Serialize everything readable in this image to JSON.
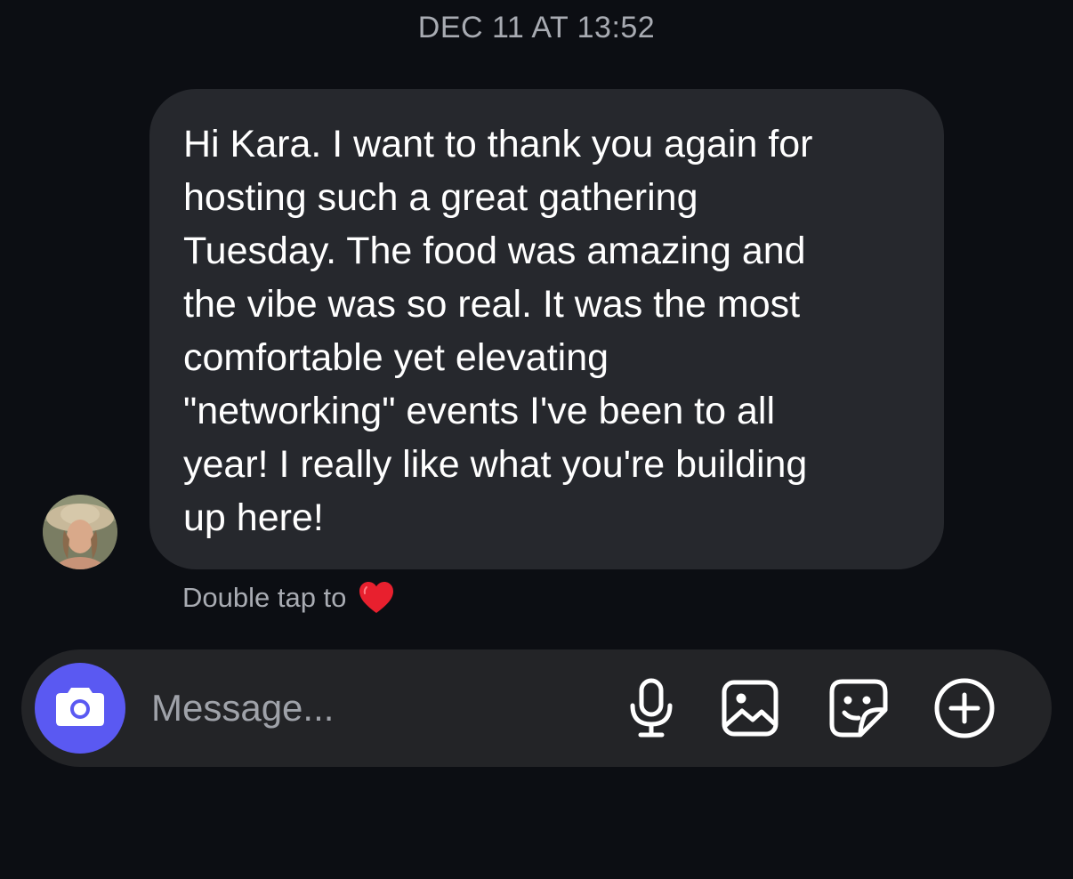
{
  "header": {
    "timestamp": "DEC 11 AT 13:52"
  },
  "message": {
    "text": "Hi Kara.  I want to thank you again for\nhosting such a great gathering\nTuesday.  The food was amazing and\nthe vibe was so real.  It was the most\ncomfortable yet elevating\n\"networking\" events I've been to all\nyear! I really like what you're building\nup here!"
  },
  "reaction_hint": {
    "label": "Double tap to"
  },
  "composer": {
    "placeholder": "Message..."
  },
  "icons": {
    "camera": "camera-icon",
    "mic": "microphone-icon",
    "gallery": "gallery-icon",
    "sticker": "sticker-icon",
    "plus": "plus-circle-icon",
    "heart": "heart-icon"
  },
  "colors": {
    "background": "#0c0e13",
    "bubble": "#26282d",
    "composer": "#232427",
    "camera_button": "#5a59f2",
    "heart": "#e8202e",
    "secondary_text": "#a9acb3"
  }
}
